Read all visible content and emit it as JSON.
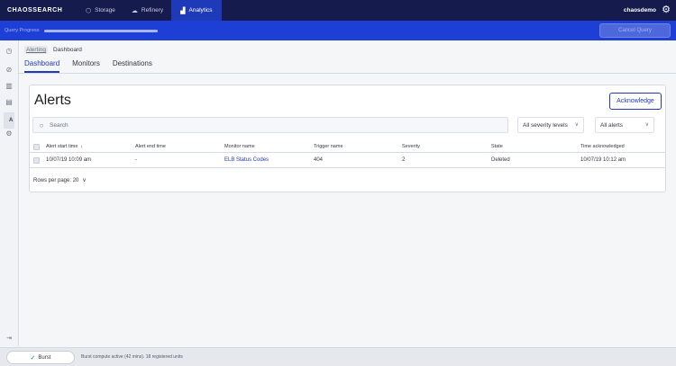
{
  "topnav": {
    "brand": "CHAOSSEARCH",
    "tabs": [
      {
        "label": "Storage",
        "icon": "storage-icon"
      },
      {
        "label": "Refinery",
        "icon": "cloud-icon"
      },
      {
        "label": "Analytics",
        "icon": "chart-icon"
      }
    ],
    "active_tab": "Analytics",
    "user": "chaosdemo"
  },
  "querybar": {
    "label": "Query Progress",
    "progress": 1.0,
    "cancel_label": "Cancel Query"
  },
  "breadcrumb": {
    "parent": "Alerting",
    "current": "Dashboard"
  },
  "tabs": [
    "Dashboard",
    "Monitors",
    "Destinations"
  ],
  "active_tab": "Dashboard",
  "alerts": {
    "title": "Alerts",
    "acknowledge_label": "Acknowledge",
    "search_placeholder": "Search",
    "severity_select": "All severity levels",
    "alerts_select": "All alerts",
    "columns": [
      "Alert start time",
      "Alert end time",
      "Monitor name",
      "Trigger name",
      "Severity",
      "State",
      "Time acknowledged"
    ],
    "sort_indicator": "↓",
    "rows": [
      {
        "start": "10/07/19 10:09 am",
        "end": "-",
        "monitor": "ELB Status Codes",
        "trigger": "404",
        "severity": "2",
        "state": "Deleted",
        "acknowledged": "10/07/19 10:12 am"
      }
    ],
    "rows_per_page": "Rows per page: 20"
  },
  "bottom": {
    "burst_label": "Burst",
    "status": "Burst compute active (42 mins). 18 registered units"
  },
  "colors": {
    "nav": "#151b4d",
    "accent": "#1f3ab8",
    "querybar": "#1d3fd6"
  }
}
